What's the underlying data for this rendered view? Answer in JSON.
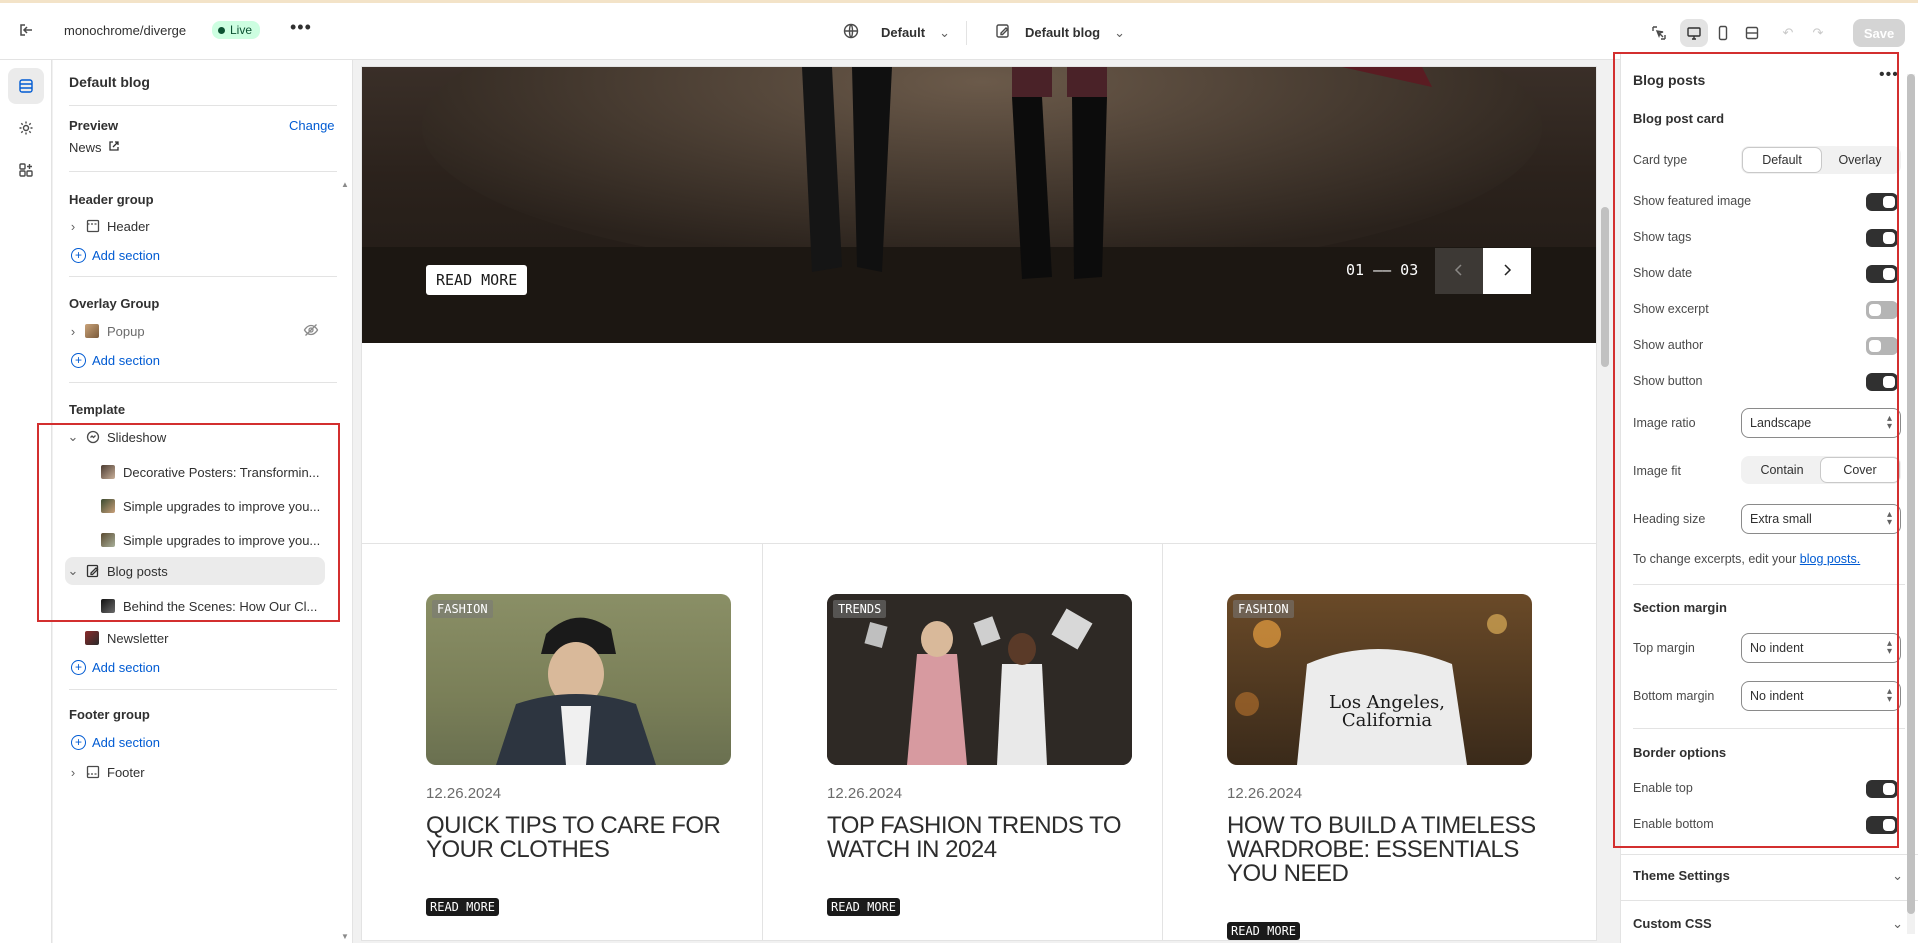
{
  "topbar": {
    "store_path": "monochrome/diverge",
    "live_label": "Live",
    "theme_label": "Default",
    "template_label": "Default blog",
    "save_label": "Save"
  },
  "sidebar": {
    "title": "Default blog",
    "preview_label": "Preview",
    "change_label": "Change",
    "preview_value": "News",
    "header_group": {
      "title": "Header group",
      "items": [
        "Header"
      ],
      "add": "Add section"
    },
    "overlay_group": {
      "title": "Overlay Group",
      "items": [
        "Popup"
      ],
      "add": "Add section"
    },
    "template": {
      "title": "Template",
      "slideshow": "Slideshow",
      "slides": [
        "Decorative Posters: Transformin...",
        "Simple upgrades to improve you...",
        "Simple upgrades to improve you..."
      ],
      "blog_posts": "Blog posts",
      "blog_child": "Behind the Scenes: How Our Cl...",
      "newsletter": "Newsletter",
      "add": "Add section"
    },
    "footer_group": {
      "title": "Footer group",
      "add": "Add section",
      "items": [
        "Footer"
      ]
    }
  },
  "preview": {
    "hero": {
      "readmore": "READ MORE",
      "counter": "01 —— 03"
    },
    "posts": [
      {
        "tag": "FASHION",
        "date": "12.26.2024",
        "title": "QUICK TIPS TO CARE FOR YOUR CLOTHES",
        "readmore": "READ MORE"
      },
      {
        "tag": "TRENDS",
        "date": "12.26.2024",
        "title": "TOP FASHION TRENDS TO WATCH IN 2024",
        "readmore": "READ MORE"
      },
      {
        "tag": "FASHION",
        "date": "12.26.2024",
        "title": "HOW TO BUILD A TIMELESS WARDROBE: ESSENTIALS YOU NEED",
        "readmore": "READ MORE",
        "image_text": "Los Angeles, California"
      }
    ]
  },
  "panel": {
    "title": "Blog posts",
    "card_heading": "Blog post card",
    "card_type": {
      "label": "Card type",
      "options": [
        "Default",
        "Overlay"
      ],
      "selected": "Default"
    },
    "toggles": [
      {
        "label": "Show featured image",
        "on": true
      },
      {
        "label": "Show tags",
        "on": true
      },
      {
        "label": "Show date",
        "on": true
      },
      {
        "label": "Show excerpt",
        "on": false
      },
      {
        "label": "Show author",
        "on": false
      },
      {
        "label": "Show button",
        "on": true
      }
    ],
    "image_ratio": {
      "label": "Image ratio",
      "value": "Landscape"
    },
    "image_fit": {
      "label": "Image fit",
      "options": [
        "Contain",
        "Cover"
      ],
      "selected": "Cover"
    },
    "heading_size": {
      "label": "Heading size",
      "value": "Extra small"
    },
    "note_prefix": "To change excerpts, edit your",
    "note_link": "blog posts.",
    "section_margin": {
      "heading": "Section margin",
      "top": {
        "label": "Top margin",
        "value": "No indent"
      },
      "bottom": {
        "label": "Bottom margin",
        "value": "No indent"
      }
    },
    "border_options": {
      "heading": "Border options",
      "top": {
        "label": "Enable top",
        "on": true
      },
      "bottom": {
        "label": "Enable bottom",
        "on": true
      }
    },
    "theme_settings": "Theme Settings",
    "custom_css": "Custom CSS"
  },
  "colors": {
    "accent": "#005bd3",
    "highlight_box": "#d32f2f",
    "live_bg": "#cdfee1"
  }
}
